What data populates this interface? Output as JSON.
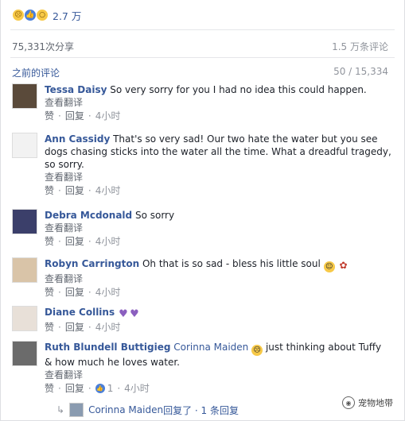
{
  "reactions": {
    "icons": [
      "sad-reaction",
      "like-reaction",
      "wow-reaction"
    ],
    "count": "2.7 万"
  },
  "stats": {
    "shares": "75,331次分享",
    "comments": "1.5 万条评论"
  },
  "comments_header": {
    "previous": "之前的评论",
    "pager": "50 / 15,334"
  },
  "actions": {
    "like": "赞",
    "reply": "回复",
    "translate": "查看翻译"
  },
  "comments": [
    {
      "name": "Tessa Daisy",
      "text": "So very sorry for you I had no idea this could happen.",
      "time": "4小时"
    },
    {
      "name": "Ann Cassidy",
      "text": "That's so very sad! Our two hate the water but you see dogs chasing sticks into the water all the time. What a dreadful tragedy, so sorry.",
      "time": "4小时"
    },
    {
      "name": "Debra Mcdonald",
      "text": "So sorry",
      "time": "4小时"
    },
    {
      "name": "Robyn Carrington",
      "text": "Oh that is so sad - bless his little soul",
      "time": "4小时"
    },
    {
      "name": "Diane Collins",
      "text": "",
      "time": "4小时"
    },
    {
      "name": "Ruth Blundell Buttigieg",
      "mention": "Corinna Maiden",
      "text": "just thinking about Tuffy & how much he loves water.",
      "time": "4小时",
      "likes": "1"
    }
  ],
  "reply_summary": {
    "name": "Corinna Maiden",
    "text": "回复了 · 1 条回复"
  },
  "watermark": "宠物地带"
}
